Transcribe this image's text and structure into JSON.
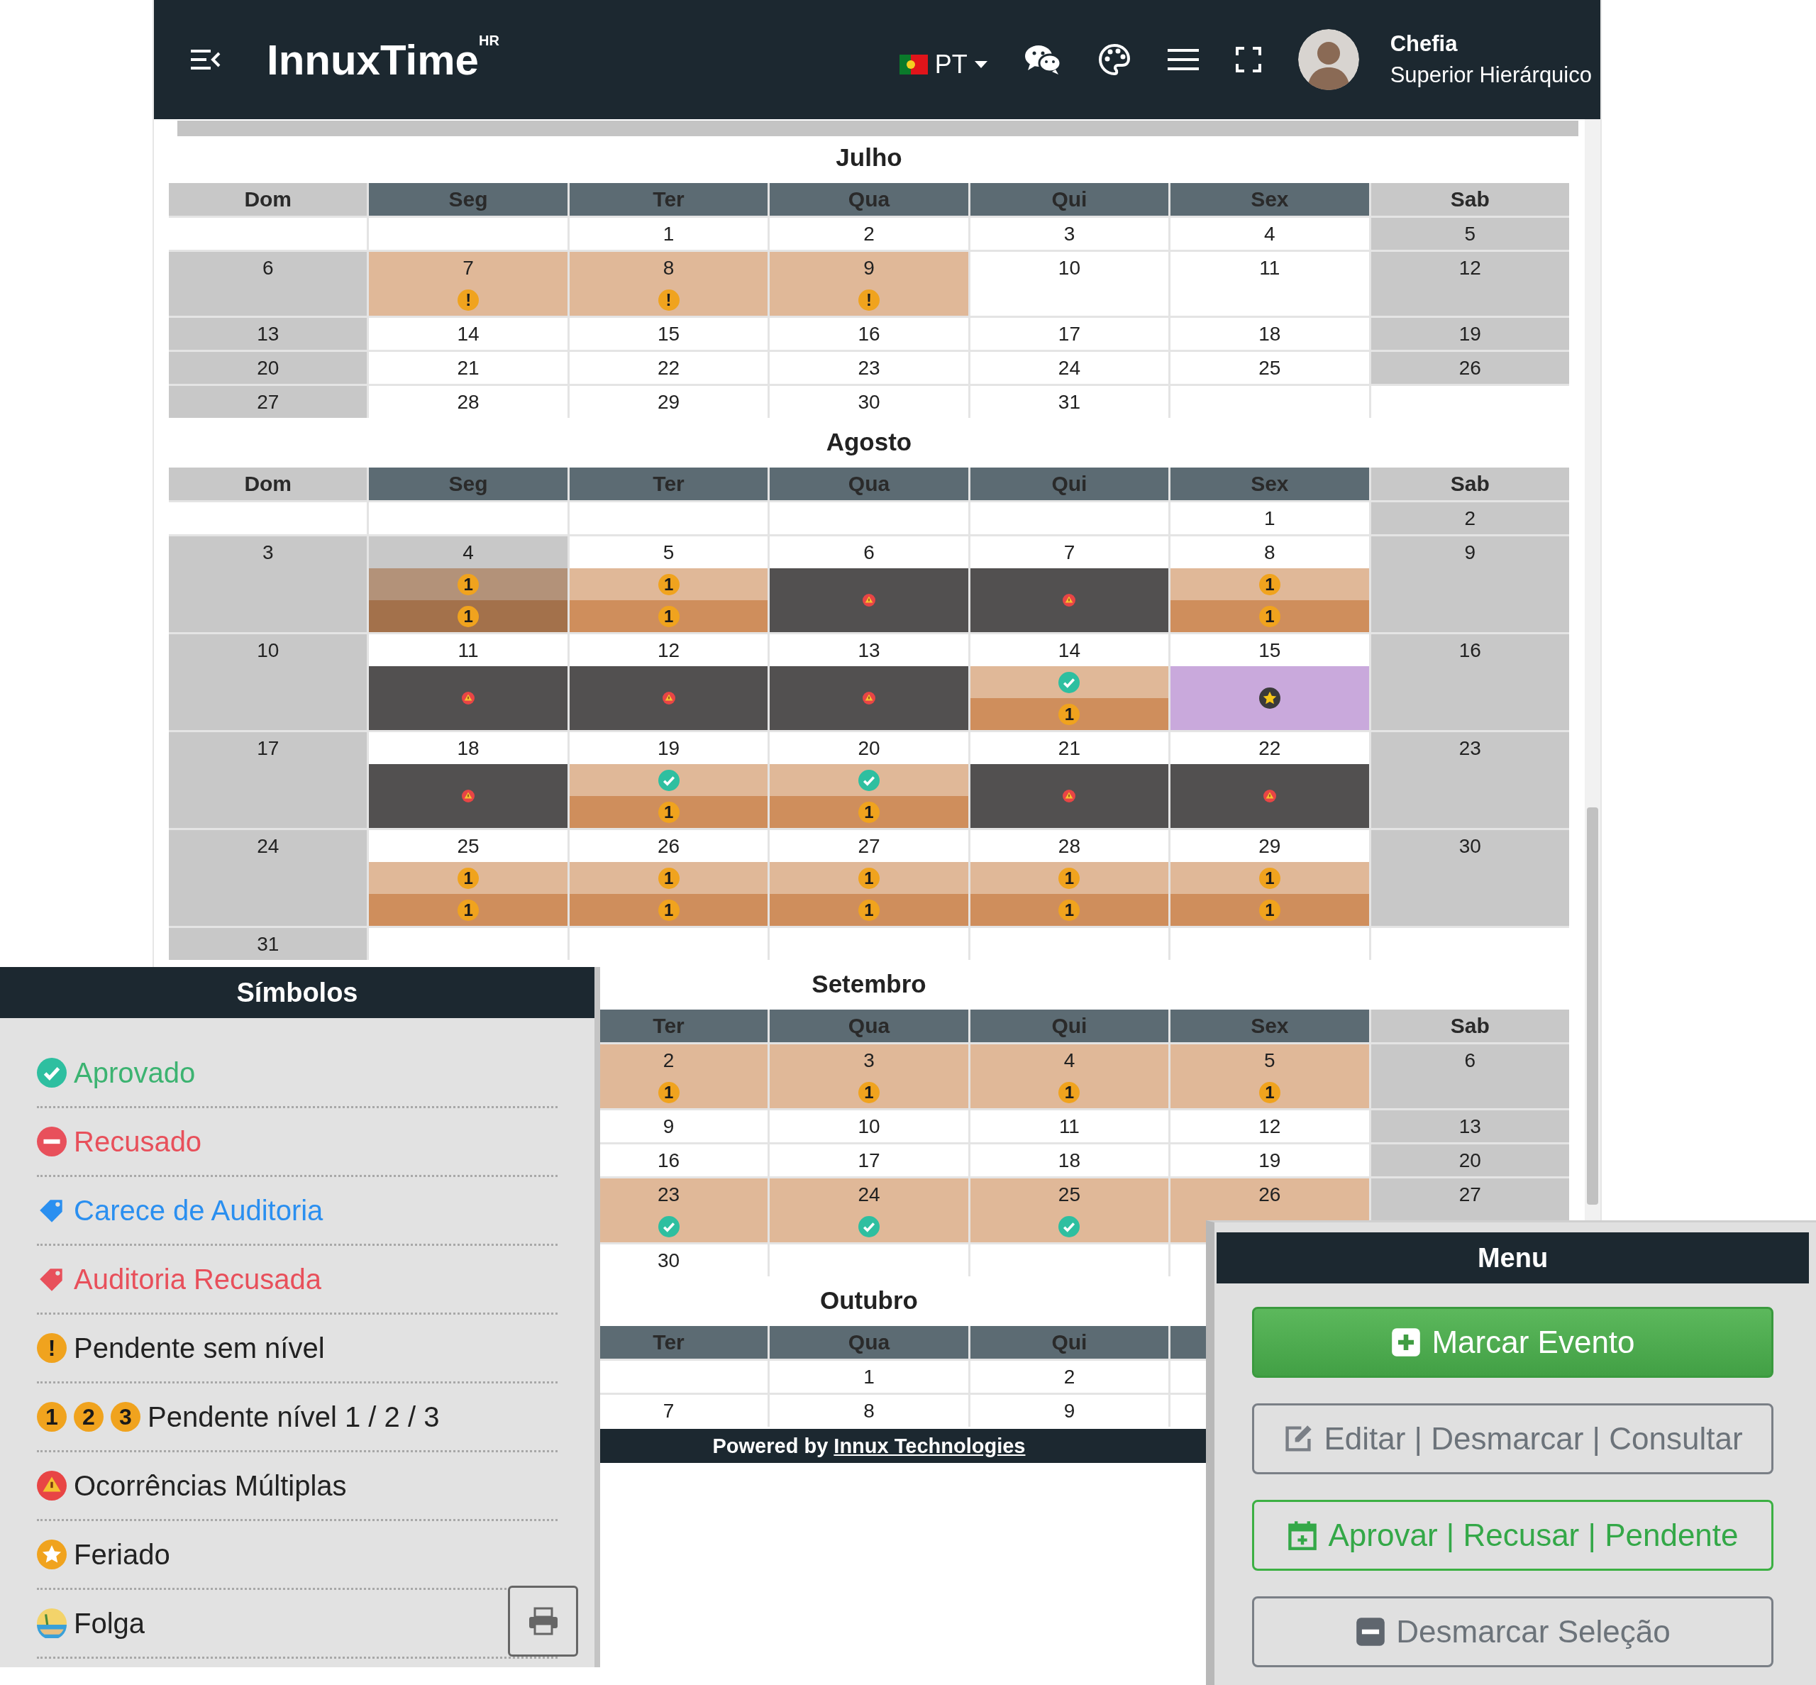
{
  "header": {
    "logo": "InnuxTime$^{HR}$",
    "language": "PT",
    "user": {
      "name": "Chefia",
      "role": "Superior Hierárquico"
    }
  },
  "months": [
    {
      "title": "Julho",
      "columns": [
        {
          "label": "Dom",
          "weekend": true
        },
        {
          "label": "Seg",
          "weekend": false
        },
        {
          "label": "Ter",
          "weekend": false
        },
        {
          "label": "Qua",
          "weekend": false
        },
        {
          "label": "Qui",
          "weekend": false
        },
        {
          "label": "Sex",
          "weekend": false
        },
        {
          "label": "Sab",
          "weekend": true
        }
      ],
      "weeks": [
        {
          "cells": [
            {
              "kind": "blank"
            },
            {
              "kind": "blank"
            },
            {
              "kind": "day",
              "day": "1"
            },
            {
              "kind": "day",
              "day": "2"
            },
            {
              "kind": "day",
              "day": "3"
            },
            {
              "kind": "day",
              "day": "4"
            },
            {
              "kind": "day",
              "day": "5"
            }
          ]
        },
        {
          "cells": [
            {
              "kind": "day",
              "day": "6"
            },
            {
              "kind": "day",
              "day": "7",
              "color": "#e0b898",
              "bands": [
                {
                  "color": "#e0b898",
                  "kind": "badge",
                  "text": "!"
                }
              ]
            },
            {
              "kind": "day",
              "day": "8",
              "color": "#e0b898",
              "bands": [
                {
                  "color": "#e0b898",
                  "kind": "badge",
                  "text": "!"
                }
              ]
            },
            {
              "kind": "day",
              "day": "9",
              "color": "#e0b898",
              "bands": [
                {
                  "color": "#e0b898",
                  "kind": "badge",
                  "text": "!"
                }
              ]
            },
            {
              "kind": "day",
              "day": "10"
            },
            {
              "kind": "day",
              "day": "11"
            },
            {
              "kind": "day",
              "day": "12"
            }
          ]
        },
        {
          "cells": [
            {
              "kind": "day",
              "day": "13"
            },
            {
              "kind": "day",
              "day": "14"
            },
            {
              "kind": "day",
              "day": "15"
            },
            {
              "kind": "day",
              "day": "16"
            },
            {
              "kind": "day",
              "day": "17"
            },
            {
              "kind": "day",
              "day": "18"
            },
            {
              "kind": "day",
              "day": "19"
            }
          ]
        },
        {
          "cells": [
            {
              "kind": "day",
              "day": "20"
            },
            {
              "kind": "day",
              "day": "21"
            },
            {
              "kind": "day",
              "day": "22"
            },
            {
              "kind": "day",
              "day": "23"
            },
            {
              "kind": "day",
              "day": "24"
            },
            {
              "kind": "day",
              "day": "25"
            },
            {
              "kind": "day",
              "day": "26"
            }
          ]
        },
        {
          "cells": [
            {
              "kind": "day",
              "day": "27"
            },
            {
              "kind": "day",
              "day": "28"
            },
            {
              "kind": "day",
              "day": "29"
            },
            {
              "kind": "day",
              "day": "30"
            },
            {
              "kind": "day",
              "day": "31"
            },
            {
              "kind": "blank"
            },
            {
              "kind": "blank"
            }
          ]
        }
      ]
    },
    {
      "title": "Agosto",
      "columns": [
        {
          "label": "Dom",
          "weekend": true
        },
        {
          "label": "Seg",
          "weekend": false
        },
        {
          "label": "Ter",
          "weekend": false
        },
        {
          "label": "Qua",
          "weekend": false
        },
        {
          "label": "Qui",
          "weekend": false
        },
        {
          "label": "Sex",
          "weekend": false
        },
        {
          "label": "Sab",
          "weekend": true
        }
      ],
      "weeks": [
        {
          "cells": [
            {
              "kind": "blank"
            },
            {
              "kind": "blank"
            },
            {
              "kind": "blank"
            },
            {
              "kind": "blank"
            },
            {
              "kind": "blank"
            },
            {
              "kind": "day",
              "day": "1"
            },
            {
              "kind": "day",
              "day": "2"
            }
          ]
        },
        {
          "cells": [
            {
              "kind": "day",
              "day": "3"
            },
            {
              "kind": "day",
              "day": "4",
              "color": "#c8c8c8",
              "bands": [
                {
                  "color": "#b39279",
                  "kind": "badge",
                  "text": "1"
                },
                {
                  "color": "#a3714b",
                  "kind": "badge",
                  "text": "1"
                }
              ]
            },
            {
              "kind": "day",
              "day": "5",
              "bands": [
                {
                  "color": "#e0b898",
                  "kind": "badge",
                  "text": "1"
                },
                {
                  "color": "#cf8e5c",
                  "kind": "badge",
                  "text": "1"
                }
              ]
            },
            {
              "kind": "day",
              "day": "6",
              "bands": [
                {
                  "color": "#525050",
                  "kind": "warning"
                }
              ]
            },
            {
              "kind": "day",
              "day": "7",
              "bands": [
                {
                  "color": "#525050",
                  "kind": "warning"
                }
              ]
            },
            {
              "kind": "day",
              "day": "8",
              "bands": [
                {
                  "color": "#e0b898",
                  "kind": "badge",
                  "text": "1"
                },
                {
                  "color": "#cf8e5c",
                  "kind": "badge",
                  "text": "1"
                }
              ]
            },
            {
              "kind": "day",
              "day": "9"
            }
          ]
        },
        {
          "cells": [
            {
              "kind": "day",
              "day": "10"
            },
            {
              "kind": "day",
              "day": "11",
              "bands": [
                {
                  "color": "#525050",
                  "kind": "warning"
                }
              ]
            },
            {
              "kind": "day",
              "day": "12",
              "bands": [
                {
                  "color": "#525050",
                  "kind": "warning"
                }
              ]
            },
            {
              "kind": "day",
              "day": "13",
              "bands": [
                {
                  "color": "#525050",
                  "kind": "warning"
                }
              ]
            },
            {
              "kind": "day",
              "day": "14",
              "bands": [
                {
                  "color": "#e0b898",
                  "kind": "check"
                },
                {
                  "color": "#cf8e5c",
                  "kind": "badge",
                  "text": "1"
                }
              ]
            },
            {
              "kind": "day",
              "day": "15",
              "bands": [
                {
                  "color": "#c9a9dc",
                  "kind": "star"
                }
              ]
            },
            {
              "kind": "day",
              "day": "16"
            }
          ]
        },
        {
          "cells": [
            {
              "kind": "day",
              "day": "17"
            },
            {
              "kind": "day",
              "day": "18",
              "bands": [
                {
                  "color": "#525050",
                  "kind": "warning"
                }
              ]
            },
            {
              "kind": "day",
              "day": "19",
              "bands": [
                {
                  "color": "#e0b898",
                  "kind": "check"
                },
                {
                  "color": "#cf8e5c",
                  "kind": "badge",
                  "text": "1"
                }
              ]
            },
            {
              "kind": "day",
              "day": "20",
              "bands": [
                {
                  "color": "#e0b898",
                  "kind": "check"
                },
                {
                  "color": "#cf8e5c",
                  "kind": "badge",
                  "text": "1"
                }
              ]
            },
            {
              "kind": "day",
              "day": "21",
              "bands": [
                {
                  "color": "#525050",
                  "kind": "warning"
                }
              ]
            },
            {
              "kind": "day",
              "day": "22",
              "bands": [
                {
                  "color": "#525050",
                  "kind": "warning"
                }
              ]
            },
            {
              "kind": "day",
              "day": "23"
            }
          ]
        },
        {
          "cells": [
            {
              "kind": "day",
              "day": "24"
            },
            {
              "kind": "day",
              "day": "25",
              "bands": [
                {
                  "color": "#e0b898",
                  "kind": "badge",
                  "text": "1"
                },
                {
                  "color": "#cf8e5c",
                  "kind": "badge",
                  "text": "1"
                }
              ]
            },
            {
              "kind": "day",
              "day": "26",
              "bands": [
                {
                  "color": "#e0b898",
                  "kind": "badge",
                  "text": "1"
                },
                {
                  "color": "#cf8e5c",
                  "kind": "badge",
                  "text": "1"
                }
              ]
            },
            {
              "kind": "day",
              "day": "27",
              "bands": [
                {
                  "color": "#e0b898",
                  "kind": "badge",
                  "text": "1"
                },
                {
                  "color": "#cf8e5c",
                  "kind": "badge",
                  "text": "1"
                }
              ]
            },
            {
              "kind": "day",
              "day": "28",
              "bands": [
                {
                  "color": "#e0b898",
                  "kind": "badge",
                  "text": "1"
                },
                {
                  "color": "#cf8e5c",
                  "kind": "badge",
                  "text": "1"
                }
              ]
            },
            {
              "kind": "day",
              "day": "29",
              "bands": [
                {
                  "color": "#e0b898",
                  "kind": "badge",
                  "text": "1"
                },
                {
                  "color": "#cf8e5c",
                  "kind": "badge",
                  "text": "1"
                }
              ]
            },
            {
              "kind": "day",
              "day": "30"
            }
          ]
        },
        {
          "cells": [
            {
              "kind": "day",
              "day": "31"
            },
            {
              "kind": "blank"
            },
            {
              "kind": "blank"
            },
            {
              "kind": "blank"
            },
            {
              "kind": "blank"
            },
            {
              "kind": "blank"
            },
            {
              "kind": "blank"
            }
          ]
        }
      ]
    },
    {
      "title": "Setembro",
      "columns": [
        null,
        null,
        {
          "label": "Ter",
          "weekend": false
        },
        {
          "label": "Qua",
          "weekend": false
        },
        {
          "label": "Qui",
          "weekend": false
        },
        {
          "label": "Sex",
          "weekend": false
        },
        {
          "label": "Sab",
          "weekend": true
        }
      ],
      "weeks": [
        {
          "cells": [
            null,
            null,
            {
              "kind": "day",
              "day": "2",
              "color": "#e0b898",
              "bands": [
                {
                  "color": "#e0b898",
                  "kind": "badge",
                  "text": "1"
                }
              ]
            },
            {
              "kind": "day",
              "day": "3",
              "color": "#e0b898",
              "bands": [
                {
                  "color": "#e0b898",
                  "kind": "badge",
                  "text": "1"
                }
              ]
            },
            {
              "kind": "day",
              "day": "4",
              "color": "#e0b898",
              "bands": [
                {
                  "color": "#e0b898",
                  "kind": "badge",
                  "text": "1"
                }
              ]
            },
            {
              "kind": "day",
              "day": "5",
              "color": "#e0b898",
              "bands": [
                {
                  "color": "#e0b898",
                  "kind": "badge",
                  "text": "1"
                }
              ]
            },
            {
              "kind": "day",
              "day": "6"
            }
          ]
        },
        {
          "cells": [
            null,
            null,
            {
              "kind": "day",
              "day": "9"
            },
            {
              "kind": "day",
              "day": "10"
            },
            {
              "kind": "day",
              "day": "11"
            },
            {
              "kind": "day",
              "day": "12"
            },
            {
              "kind": "day",
              "day": "13"
            }
          ]
        },
        {
          "cells": [
            null,
            null,
            {
              "kind": "day",
              "day": "16"
            },
            {
              "kind": "day",
              "day": "17"
            },
            {
              "kind": "day",
              "day": "18"
            },
            {
              "kind": "day",
              "day": "19"
            },
            {
              "kind": "day",
              "day": "20"
            }
          ]
        },
        {
          "cells": [
            null,
            null,
            {
              "kind": "day",
              "day": "23",
              "color": "#e0b898",
              "bands": [
                {
                  "color": "#e0b898",
                  "kind": "check"
                }
              ]
            },
            {
              "kind": "day",
              "day": "24",
              "color": "#e0b898",
              "bands": [
                {
                  "color": "#e0b898",
                  "kind": "check"
                }
              ]
            },
            {
              "kind": "day",
              "day": "25",
              "color": "#e0b898",
              "bands": [
                {
                  "color": "#e0b898",
                  "kind": "check"
                }
              ]
            },
            {
              "kind": "day",
              "day": "26",
              "color": "#e0b898"
            },
            {
              "kind": "day",
              "day": "27"
            }
          ]
        },
        {
          "cells": [
            null,
            null,
            {
              "kind": "day",
              "day": "30"
            },
            {
              "kind": "blank"
            },
            {
              "kind": "blank"
            },
            {
              "kind": "blank"
            },
            null
          ]
        }
      ]
    },
    {
      "title": "Outubro",
      "columns": [
        null,
        null,
        {
          "label": "Ter",
          "weekend": false
        },
        {
          "label": "Qua",
          "weekend": false
        },
        {
          "label": "Qui",
          "weekend": false
        },
        {
          "weekend": false
        },
        null
      ],
      "weeks": [
        {
          "cells": [
            null,
            null,
            {
              "kind": "blank"
            },
            {
              "kind": "day",
              "day": "1"
            },
            {
              "kind": "day",
              "day": "2"
            },
            {
              "kind": "blank"
            },
            null
          ]
        },
        {
          "cells": [
            null,
            null,
            {
              "kind": "day",
              "day": "7"
            },
            {
              "kind": "day",
              "day": "8"
            },
            {
              "kind": "day",
              "day": "9"
            },
            {
              "kind": "blank"
            },
            null
          ]
        }
      ]
    }
  ],
  "footer": {
    "text": "Powered by",
    "link": "Innux Technologies"
  },
  "legend": {
    "title": "Símbolos",
    "items": [
      {
        "label": "Aprovado",
        "kind": "approved",
        "color": "#3cb371"
      },
      {
        "label": "Recusado",
        "kind": "refused",
        "color": "#e8505b"
      },
      {
        "label": "Carece de Auditoria",
        "kind": "audit",
        "color": "#2a8ff0"
      },
      {
        "label": "Auditoria Recusada",
        "kind": "audit-refused",
        "color": "#e8505b"
      },
      {
        "label": "Pendente sem nível",
        "kind": "badges",
        "color": "#222222",
        "badges": [
          "!"
        ]
      },
      {
        "label": "Pendente nível 1 / 2 / 3",
        "kind": "badges",
        "color": "#222222",
        "badges": [
          "1",
          "2",
          "3"
        ]
      },
      {
        "label": "Ocorrências Múltiplas",
        "kind": "multiple",
        "color": "#222222"
      },
      {
        "label": "Feriado",
        "kind": "holiday",
        "color": "#222222"
      },
      {
        "label": "Folga",
        "kind": "day-off",
        "color": "#222222"
      }
    ]
  },
  "menu": {
    "title": "Menu",
    "buttons": [
      {
        "label": "Marcar Evento",
        "kind": "primary"
      },
      {
        "label": "Editar | Desmarcar | Consultar",
        "kind": "edit"
      },
      {
        "label": "Aprovar | Recusar | Pendente",
        "kind": "success"
      },
      {
        "label": "Desmarcar Seleção",
        "kind": "clear"
      }
    ]
  }
}
